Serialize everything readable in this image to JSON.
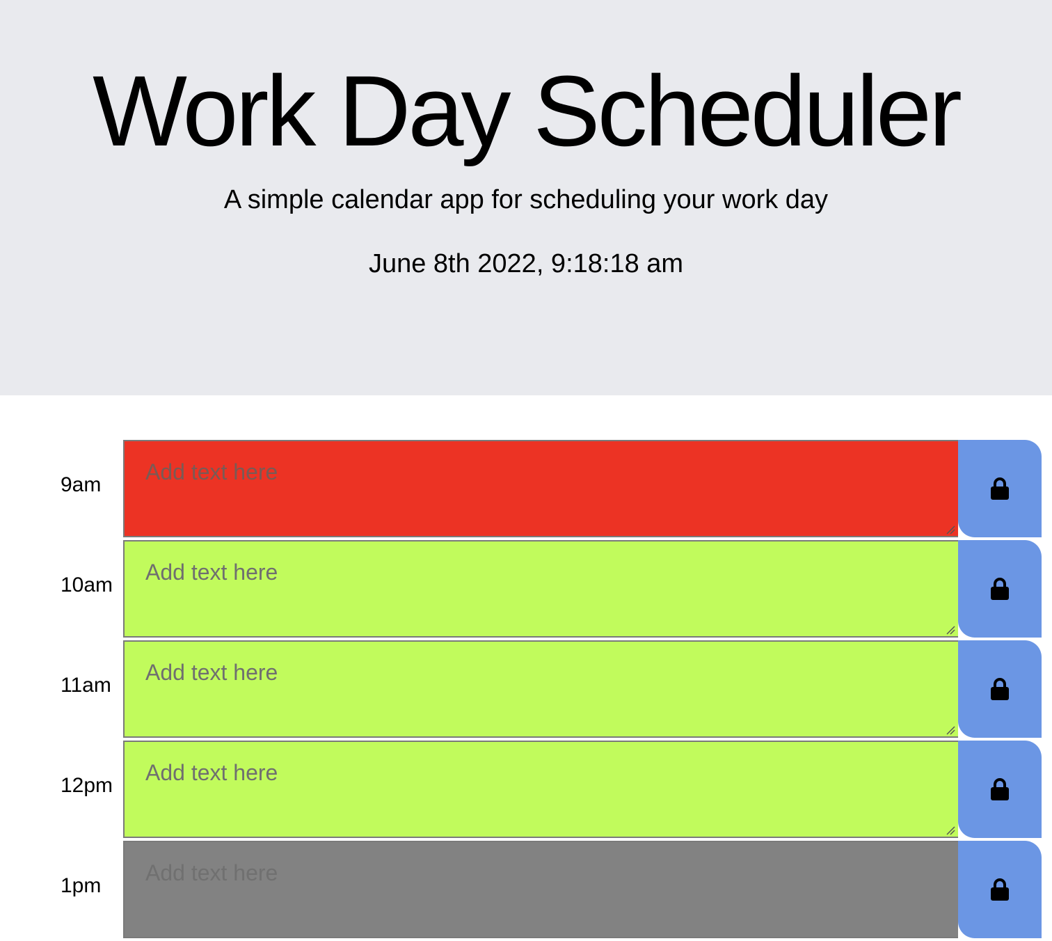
{
  "header": {
    "title": "Work Day Scheduler",
    "subtitle": "A simple calendar app for scheduling your work day",
    "datetime": "June 8th 2022, 9:18:18 am"
  },
  "colors": {
    "past": "#828282",
    "present": "#ec3324",
    "future": "#c1fb5c",
    "save_button": "#6b96e4",
    "header_bg": "#e9eaee"
  },
  "rows": [
    {
      "hour": "9am",
      "placeholder": "Add text here",
      "status": "present",
      "value": "",
      "save_icon": "lock-icon"
    },
    {
      "hour": "10am",
      "placeholder": "Add text here",
      "status": "future",
      "value": "",
      "save_icon": "lock-icon"
    },
    {
      "hour": "11am",
      "placeholder": "Add text here",
      "status": "future",
      "value": "",
      "save_icon": "lock-icon"
    },
    {
      "hour": "12pm",
      "placeholder": "Add text here",
      "status": "future",
      "value": "",
      "save_icon": "lock-icon"
    },
    {
      "hour": "1pm",
      "placeholder": "Add text here",
      "status": "past",
      "value": "",
      "save_icon": "lock-icon"
    }
  ]
}
